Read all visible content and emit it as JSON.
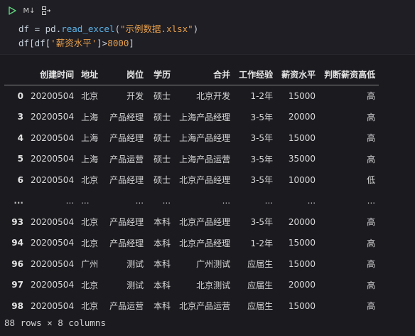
{
  "toolbar": {
    "run_icon": "play-icon",
    "markdown_label": "M↓",
    "split_icon": "split-cell-icon"
  },
  "code": {
    "line1": {
      "var": "df",
      "eq": " = ",
      "obj": "pd.",
      "fn": "read_excel",
      "open": "(",
      "arg": "\"示例数据.xlsx\"",
      "close": ")"
    },
    "line2": {
      "var": "df",
      "open": "[",
      "inner": "df[",
      "key": "'薪资水平'",
      "close_key": "]",
      "op": ">",
      "num": "8000",
      "close": "]"
    }
  },
  "table": {
    "columns": [
      "",
      "创建时间",
      "地址",
      "岗位",
      "学历",
      "合并",
      "工作经验",
      "薪资水平",
      "判断薪资高低"
    ],
    "rows": [
      {
        "index": "0",
        "cells": [
          "20200504",
          "北京",
          "开发",
          "硕士",
          "北京开发",
          "1-2年",
          "15000",
          "高"
        ]
      },
      {
        "index": "3",
        "cells": [
          "20200504",
          "上海",
          "产品经理",
          "硕士",
          "上海产品经理",
          "3-5年",
          "20000",
          "高"
        ]
      },
      {
        "index": "4",
        "cells": [
          "20200504",
          "上海",
          "产品经理",
          "硕士",
          "上海产品经理",
          "3-5年",
          "15000",
          "高"
        ]
      },
      {
        "index": "5",
        "cells": [
          "20200504",
          "上海",
          "产品运营",
          "硕士",
          "上海产品运营",
          "3-5年",
          "35000",
          "高"
        ]
      },
      {
        "index": "6",
        "cells": [
          "20200504",
          "北京",
          "产品经理",
          "硕士",
          "北京产品经理",
          "3-5年",
          "10000",
          "低"
        ]
      },
      {
        "index": "...",
        "cells": [
          "...",
          "...",
          "...",
          "...",
          "...",
          "...",
          "...",
          "..."
        ]
      },
      {
        "index": "93",
        "cells": [
          "20200504",
          "北京",
          "产品经理",
          "本科",
          "北京产品经理",
          "3-5年",
          "20000",
          "高"
        ]
      },
      {
        "index": "94",
        "cells": [
          "20200504",
          "北京",
          "产品经理",
          "本科",
          "北京产品经理",
          "1-2年",
          "15000",
          "高"
        ]
      },
      {
        "index": "96",
        "cells": [
          "20200504",
          "广州",
          "测试",
          "本科",
          "广州测试",
          "应届生",
          "15000",
          "高"
        ]
      },
      {
        "index": "97",
        "cells": [
          "20200504",
          "北京",
          "测试",
          "本科",
          "北京测试",
          "应届生",
          "20000",
          "高"
        ]
      },
      {
        "index": "98",
        "cells": [
          "20200504",
          "北京",
          "产品运营",
          "本科",
          "北京产品运营",
          "应届生",
          "15000",
          "高"
        ]
      }
    ]
  },
  "summary": "88 rows × 8 columns"
}
